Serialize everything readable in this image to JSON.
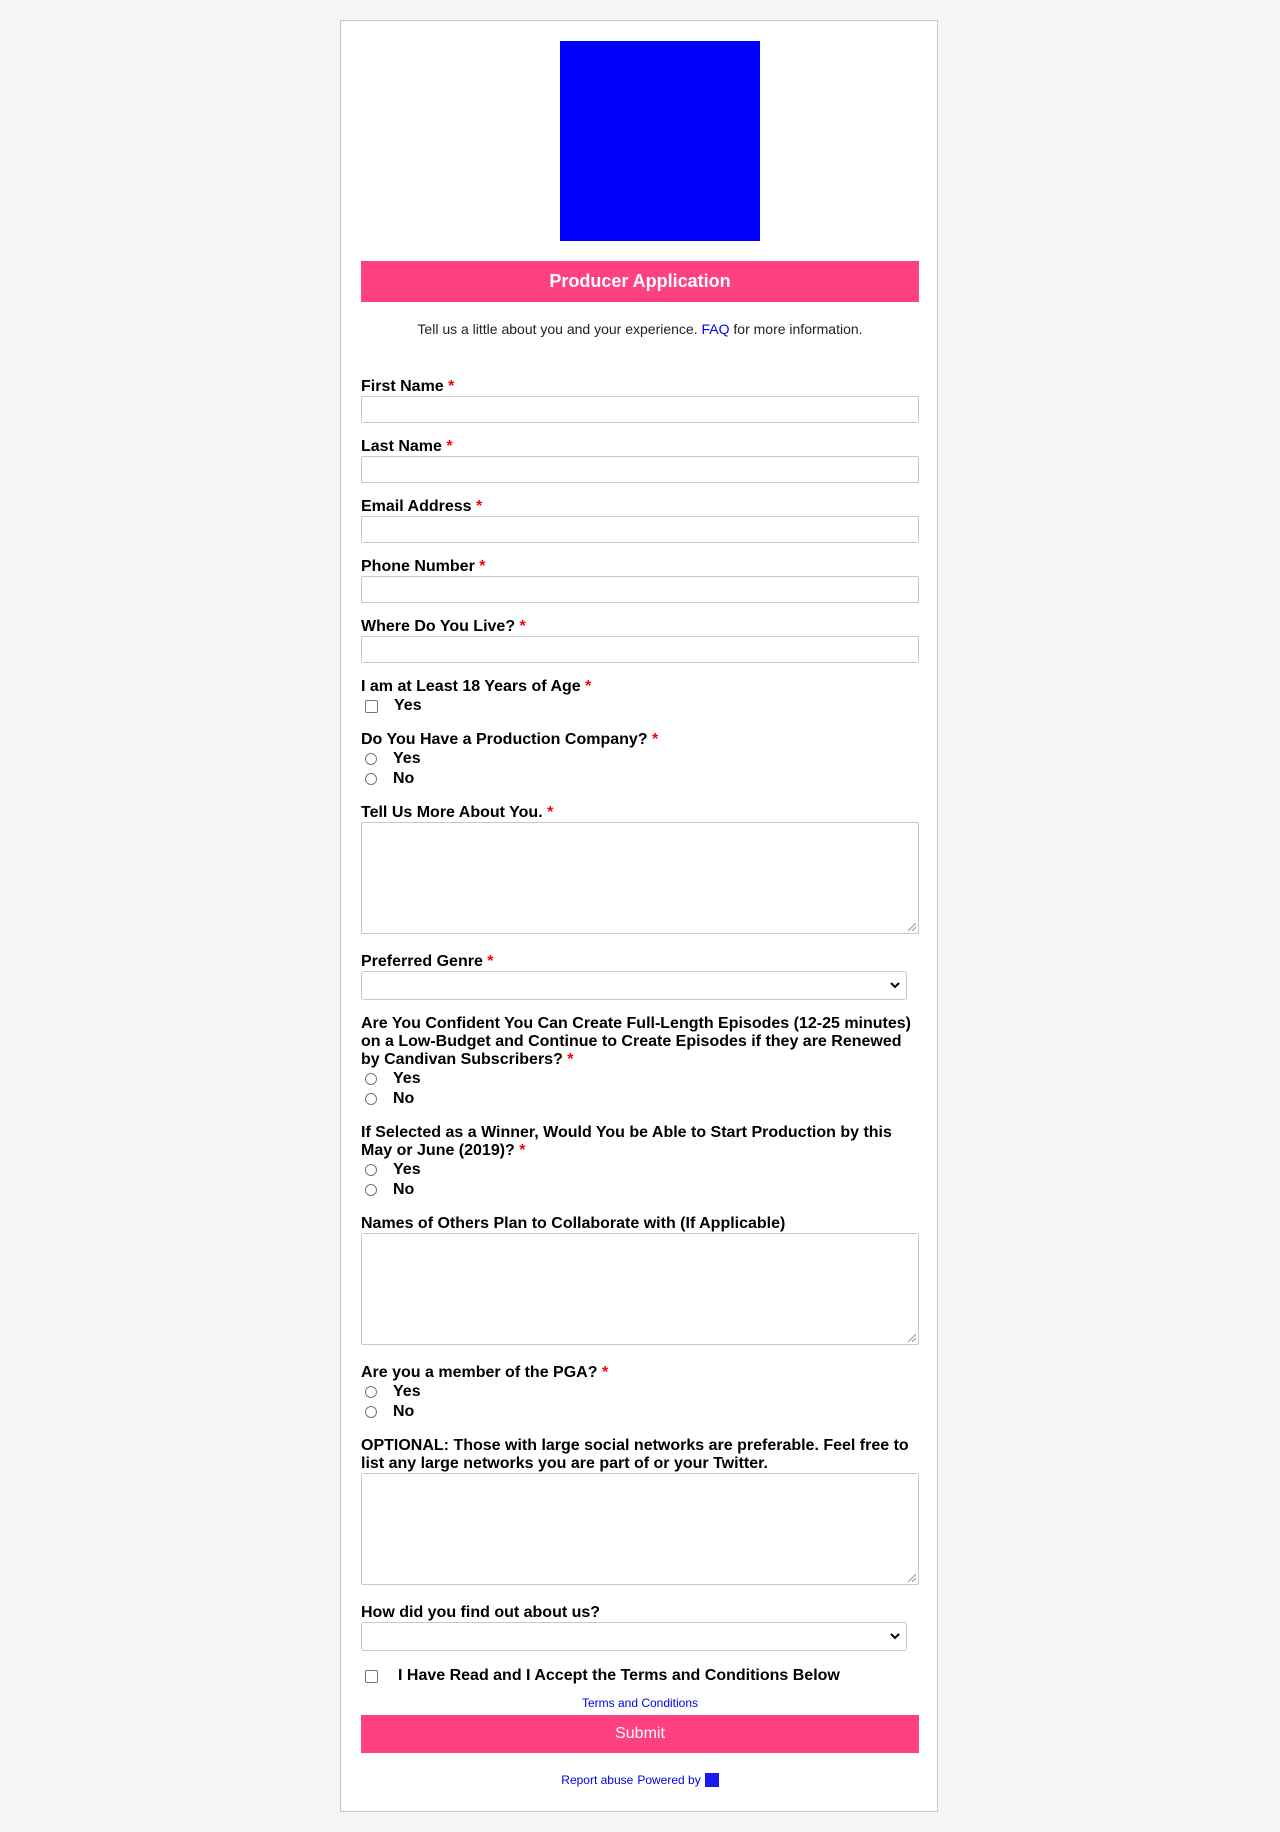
{
  "form": {
    "title": "Producer Application",
    "intro_before": "Tell us a little about you and your experience. ",
    "intro_link": "FAQ",
    "intro_after": " for more information.",
    "required_mark": "*",
    "fields": {
      "first_name": "First Name",
      "last_name": "Last Name",
      "email": "Email Address",
      "phone": "Phone Number",
      "location": "Where Do You Live?",
      "age": "I am at Least 18 Years of Age",
      "production_company": "Do You Have a Production Company?",
      "about": "Tell Us More About You.",
      "genre": "Preferred Genre",
      "confident": "Are You Confident You Can Create Full-Length Episodes (12-25 minutes) on a Low-Budget and Continue to Create Episodes if they are Renewed by Candivan Subscribers?",
      "start_production": "If Selected as a Winner, Would You be Able to Start Production by this May or June (2019)?",
      "collaborators": "Names of Others Plan to Collaborate with (If Applicable)",
      "pga": "Are you a member of the PGA?",
      "social": "OPTIONAL: Those with large social networks are preferable. Feel free to list any large networks you are part of or your Twitter.",
      "referral": "How did you find out about us?",
      "accept_terms": "I Have Read and I Accept the Terms and Conditions Below"
    },
    "options": {
      "yes": "Yes",
      "no": "No"
    },
    "terms_link": "Terms and Conditions",
    "submit": "Submit",
    "footer": {
      "report": "Report abuse",
      "powered": "Powered by"
    },
    "colors": {
      "accent": "#ff4081",
      "logo": "#0000ff",
      "required": "#ff0000",
      "link": "#0000ee"
    }
  }
}
